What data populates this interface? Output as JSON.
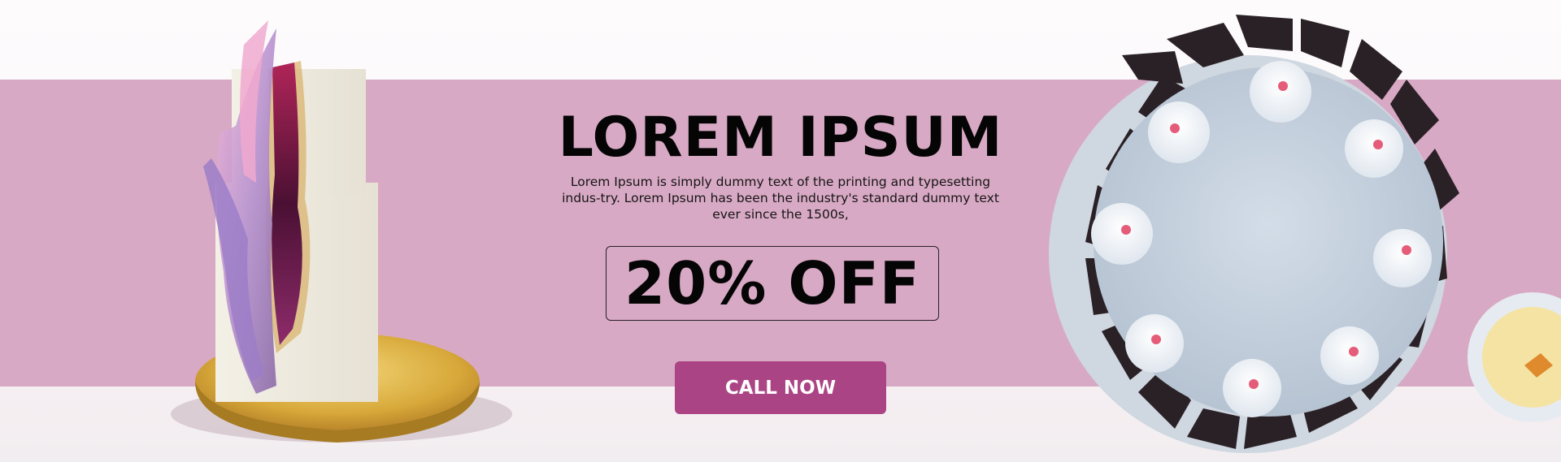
{
  "banner": {
    "headline": "LOREM IPSUM",
    "description": "Lorem Ipsum is simply dummy text of the printing and typesetting indus-try. Lorem Ipsum has been the industry's standard dummy text ever since the 1500s,",
    "offer": "20% OFF",
    "cta_label": "CALL NOW"
  },
  "colors": {
    "band": "#d8a9c4",
    "cta": "#ab4484",
    "text": "#050505"
  },
  "icons": {
    "left": "geode-cake-image",
    "right": "chocolate-cream-cake-image",
    "corner": "dessert-bowl-image"
  }
}
